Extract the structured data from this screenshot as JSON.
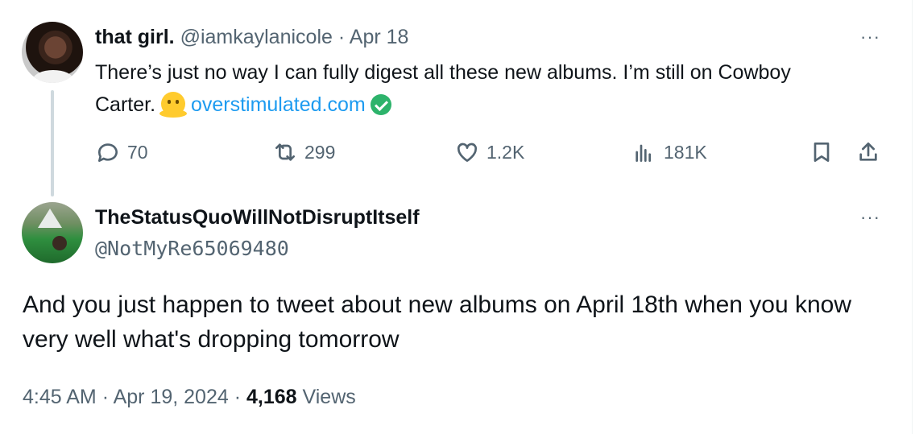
{
  "tweet1": {
    "display_name": "that girl.",
    "handle": "@iamkaylanicole",
    "sep": "·",
    "date": "Apr 18",
    "text_part1": "There’s just no way I can fully digest all these new albums. I’m still on Cowboy Carter.",
    "link_text": "overstimulated.com",
    "more": "···",
    "actions": {
      "replies": "70",
      "retweets": "299",
      "likes": "1.2K",
      "views": "181K"
    }
  },
  "tweet2": {
    "display_name": "TheStatusQuoWillNotDisruptItself",
    "handle": "@NotMyRe65069480",
    "more": "···",
    "text": "And you just happen to tweet about new albums on April 18th when you know very well what's dropping tomorrow",
    "time": "4:45 AM",
    "sep1": "·",
    "date": "Apr 19, 2024",
    "sep2": "·",
    "views_count": "4,168",
    "views_label": "Views"
  },
  "colors": {
    "link": "#1d9bf0",
    "muted": "#536471",
    "text": "#0f1419",
    "verified": "#2db36b"
  }
}
